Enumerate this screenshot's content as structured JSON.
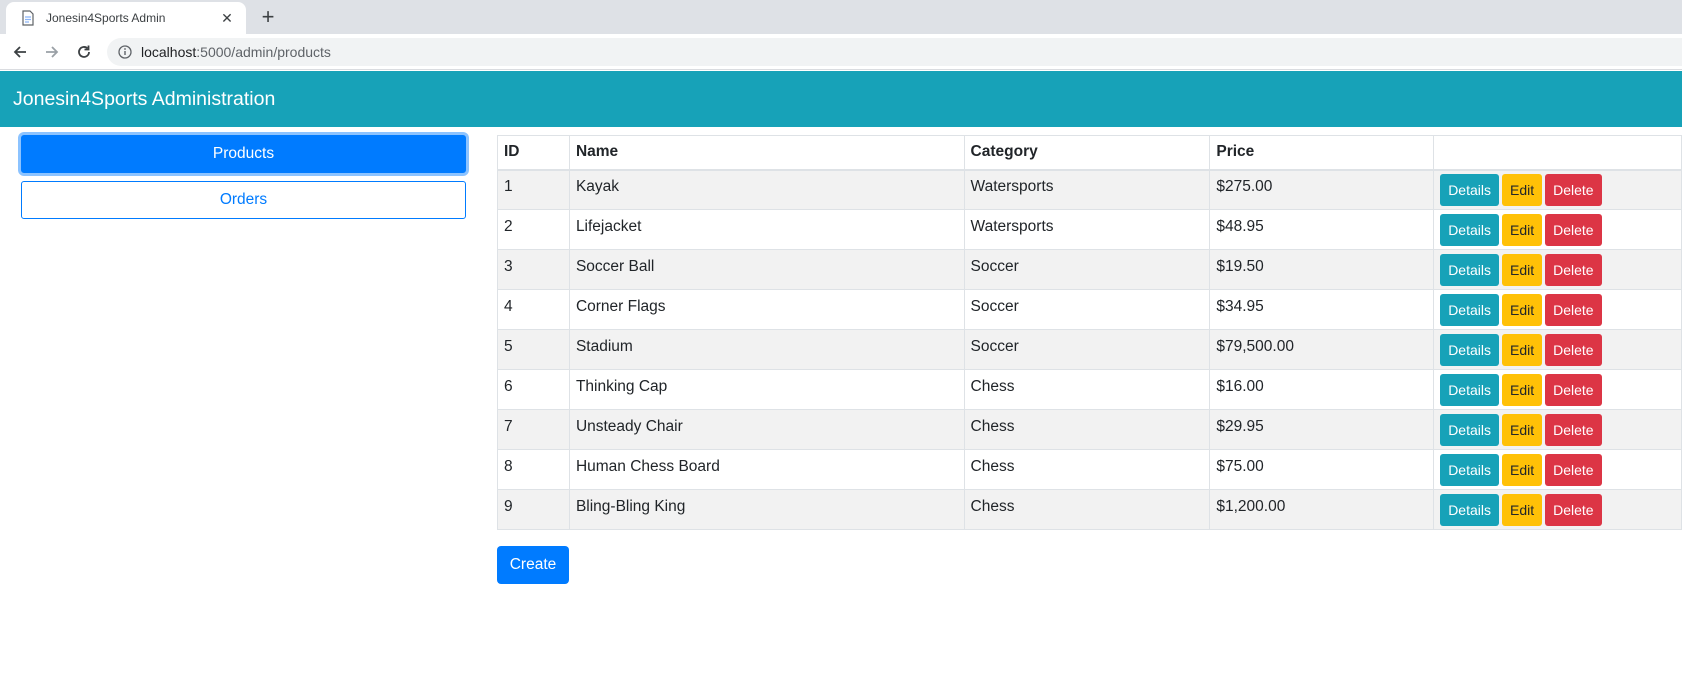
{
  "browser": {
    "tab_title": "Jonesin4Sports Admin",
    "tab_close": "✕",
    "new_tab": "+",
    "url_host": "localhost",
    "url_rest": ":5000/admin/products",
    "icons": [
      "document-icon",
      "close-icon",
      "plus-icon",
      "back-arrow-icon",
      "forward-arrow-icon",
      "reload-icon",
      "info-icon"
    ]
  },
  "header": {
    "title": "Jonesin4Sports Administration"
  },
  "sidebar": {
    "items": [
      {
        "label": "Products",
        "active": true
      },
      {
        "label": "Orders",
        "active": false
      }
    ]
  },
  "table": {
    "columns": [
      "ID",
      "Name",
      "Category",
      "Price",
      ""
    ],
    "rows": [
      {
        "id": "1",
        "name": "Kayak",
        "category": "Watersports",
        "price": "$275.00"
      },
      {
        "id": "2",
        "name": "Lifejacket",
        "category": "Watersports",
        "price": "$48.95"
      },
      {
        "id": "3",
        "name": "Soccer Ball",
        "category": "Soccer",
        "price": "$19.50"
      },
      {
        "id": "4",
        "name": "Corner Flags",
        "category": "Soccer",
        "price": "$34.95"
      },
      {
        "id": "5",
        "name": "Stadium",
        "category": "Soccer",
        "price": "$79,500.00"
      },
      {
        "id": "6",
        "name": "Thinking Cap",
        "category": "Chess",
        "price": "$16.00"
      },
      {
        "id": "7",
        "name": "Unsteady Chair",
        "category": "Chess",
        "price": "$29.95"
      },
      {
        "id": "8",
        "name": "Human Chess Board",
        "category": "Chess",
        "price": "$75.00"
      },
      {
        "id": "9",
        "name": "Bling-Bling King",
        "category": "Chess",
        "price": "$1,200.00"
      }
    ],
    "actions": {
      "details": "Details",
      "edit": "Edit",
      "delete": "Delete"
    }
  },
  "create_label": "Create",
  "colors": {
    "header_bg": "#17a2b8",
    "primary": "#007bff",
    "info": "#17a2b8",
    "warning": "#ffc107",
    "danger": "#dc3545",
    "stripe": "#f2f2f2"
  }
}
